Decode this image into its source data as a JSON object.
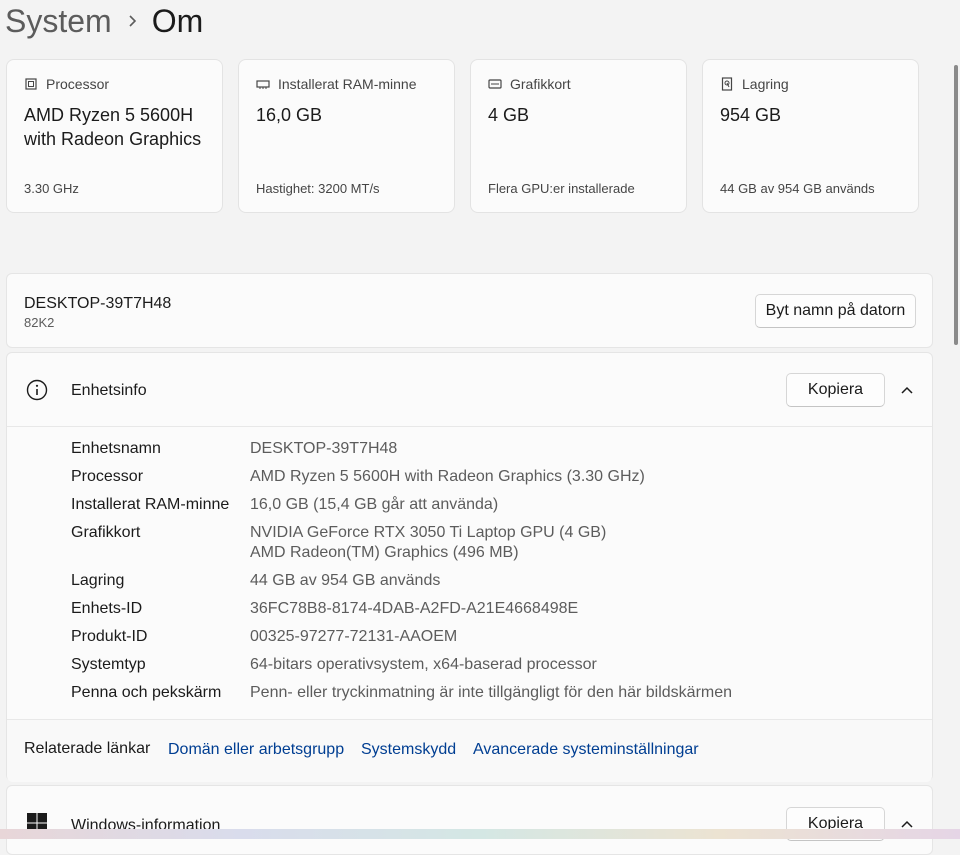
{
  "breadcrumb": {
    "parent": "System",
    "current": "Om"
  },
  "specs": [
    {
      "icon": "processor-icon",
      "label": "Processor",
      "value": "AMD Ryzen 5 5600H with Radeon Graphics",
      "sub": "3.30 GHz"
    },
    {
      "icon": "memory-icon",
      "label": "Installerat RAM-minne",
      "value": "16,0 GB",
      "sub": "Hastighet: 3200 MT/s"
    },
    {
      "icon": "graphics-card-icon",
      "label": "Grafikkort",
      "value": "4 GB",
      "sub": "Flera GPU:er installerade"
    },
    {
      "icon": "storage-icon",
      "label": "Lagring",
      "value": "954 GB",
      "sub": "44 GB av 954 GB används"
    }
  ],
  "device": {
    "name": "DESKTOP-39T7H48",
    "model": "82K2",
    "rename_label": "Byt namn på datorn"
  },
  "device_info": {
    "title": "Enhetsinfo",
    "copy_label": "Kopiera",
    "rows": [
      {
        "label": "Enhetsnamn",
        "value": "DESKTOP-39T7H48"
      },
      {
        "label": "Processor",
        "value": "AMD Ryzen 5 5600H with Radeon Graphics (3.30 GHz)"
      },
      {
        "label": "Installerat RAM-minne",
        "value": "16,0 GB (15,4 GB går att använda)"
      },
      {
        "label": "Grafikkort",
        "value": "NVIDIA GeForce RTX 3050 Ti Laptop GPU (4 GB)",
        "value2": "AMD Radeon(TM) Graphics (496 MB)"
      },
      {
        "label": "Lagring",
        "value": "44 GB av 954 GB används"
      },
      {
        "label": "Enhets-ID",
        "value": "36FC78B8-8174-4DAB-A2FD-A21E4668498E"
      },
      {
        "label": "Produkt-ID",
        "value": "00325-97277-72131-AAOEM"
      },
      {
        "label": "Systemtyp",
        "value": "64-bitars operativsystem, x64-baserad processor"
      },
      {
        "label": "Penna och pekskärm",
        "value": "Penn- eller tryckinmatning är inte tillgängligt för den här bildskärmen"
      }
    ]
  },
  "related": {
    "label": "Relaterade länkar",
    "links": [
      "Domän eller arbetsgrupp",
      "Systemskydd",
      "Avancerade systeminställningar"
    ]
  },
  "windows_info": {
    "title": "Windows-information",
    "copy_label": "Kopiera"
  },
  "colors": {
    "link": "#003e92",
    "background": "#f3f3f3",
    "card": "#fbfbfb"
  }
}
